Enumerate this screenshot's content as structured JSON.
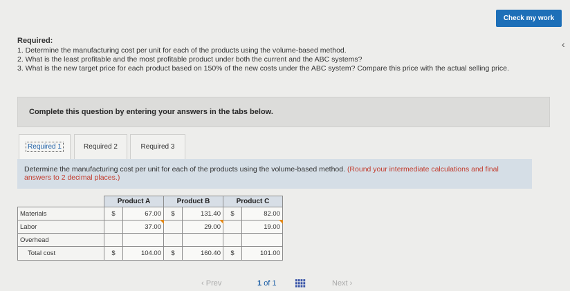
{
  "header": {
    "check_button": "Check my work",
    "chevron": "‹"
  },
  "required": {
    "title": "Required:",
    "items": [
      "1. Determine the manufacturing cost per unit for each of the products using the volume-based method.",
      "2. What is the least profitable and the most profitable product under both the current and the ABC systems?",
      "3. What is the new target price for each product based on 150% of the new costs under the ABC system? Compare this price with the actual selling price."
    ]
  },
  "instruction": "Complete this question by entering your answers in the tabs below.",
  "tabs": [
    {
      "label": "Required 1",
      "active": true
    },
    {
      "label": "Required 2",
      "active": false
    },
    {
      "label": "Required 3",
      "active": false
    }
  ],
  "question": {
    "text": "Determine the manufacturing cost per unit for each of the products using the volume-based method.",
    "hint": "(Round your intermediate calculations and final answers to 2 decimal places.)"
  },
  "table": {
    "columns": [
      "Product A",
      "Product B",
      "Product C"
    ],
    "rows": {
      "materials": {
        "label": "Materials",
        "d1": "$",
        "a": "67.00",
        "d2": "$",
        "b": "131.40",
        "d3": "$",
        "c": "82.00"
      },
      "labor": {
        "label": "Labor",
        "d1": "",
        "a": "37.00",
        "d2": "",
        "b": "29.00",
        "d3": "",
        "c": "19.00"
      },
      "overhead": {
        "label": "Overhead",
        "d1": "",
        "a": "",
        "d2": "",
        "b": "",
        "d3": "",
        "c": ""
      },
      "total": {
        "label": "Total cost",
        "d1": "$",
        "a": "104.00",
        "d2": "$",
        "b": "160.40",
        "d3": "$",
        "c": "101.00"
      }
    }
  },
  "pager": {
    "prev": "Prev",
    "page": "1",
    "of": "of",
    "total": "1",
    "next": "Next",
    "grid_icon_color": "#3a55a8"
  }
}
